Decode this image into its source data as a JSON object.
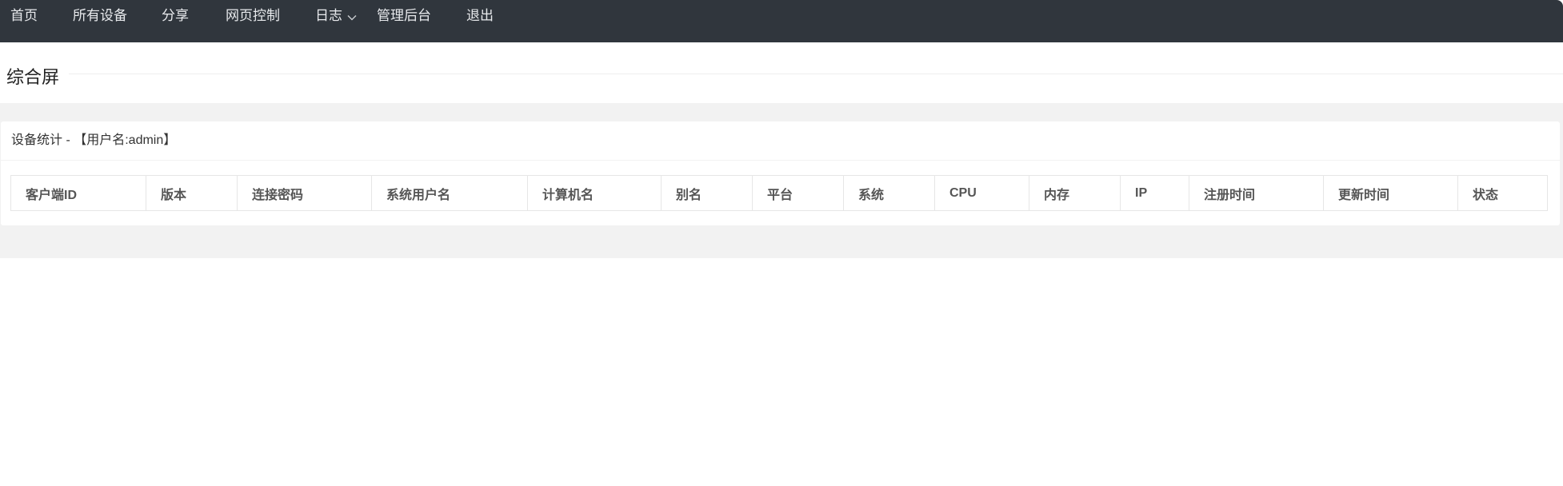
{
  "nav": {
    "home": "首页",
    "all_devices": "所有设备",
    "share": "分享",
    "web_control": "网页控制",
    "logs": "日志",
    "admin": "管理后台",
    "logout": "退出"
  },
  "page": {
    "title": "综合屏"
  },
  "card": {
    "header": "设备统计 - 【用户名:admin】",
    "columns": [
      "客户端ID",
      "版本",
      "连接密码",
      "系统用户名",
      "计算机名",
      "别名",
      "平台",
      "系统",
      "CPU",
      "内存",
      "IP",
      "注册时间",
      "更新时间",
      "状态"
    ]
  },
  "colors": {
    "nav_bg": "#30363d",
    "panel_bg": "#f2f2f2",
    "border": "#e6e6e6"
  }
}
